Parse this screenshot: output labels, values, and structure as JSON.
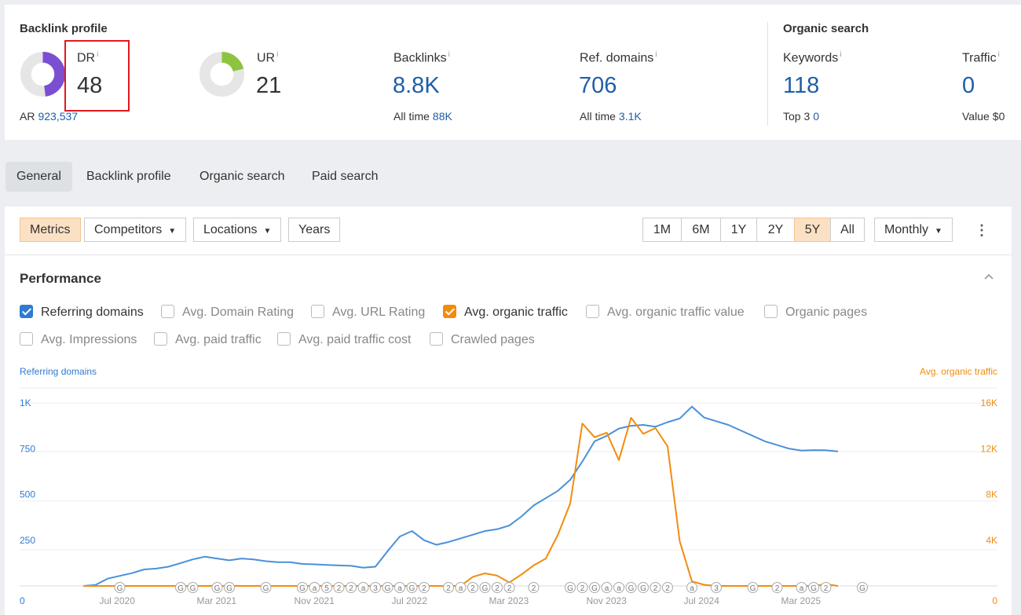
{
  "summary": {
    "backlink_title": "Backlink profile",
    "organic_title": "Organic search",
    "dr": {
      "label": "DR",
      "info": "i",
      "value": "48",
      "fraction": 0.48
    },
    "ar": {
      "label": "AR",
      "value": "923,537"
    },
    "ur": {
      "label": "UR",
      "info": "i",
      "value": "21",
      "fraction": 0.21
    },
    "backlinks": {
      "label": "Backlinks",
      "info": "i",
      "value": "8.8K",
      "sub_label": "All time",
      "sub_value": "88K"
    },
    "ref_domains": {
      "label": "Ref. domains",
      "info": "i",
      "value": "706",
      "sub_label": "All time",
      "sub_value": "3.1K"
    },
    "keywords": {
      "label": "Keywords",
      "info": "i",
      "value": "118",
      "sub_label": "Top 3",
      "sub_value": "0"
    },
    "traffic": {
      "label": "Traffic",
      "info": "i",
      "value": "0",
      "sub_label": "Value",
      "sub_value": "$0"
    }
  },
  "colors": {
    "dr_purple": "#7b4fd1",
    "ur_green": "#8cc43f",
    "blue": "#1f5ea8",
    "series_blue": "#4a90d9",
    "series_orange": "#f28c0e",
    "highlight_red": "#e0191f"
  },
  "tabs": [
    {
      "label": "General",
      "active": true
    },
    {
      "label": "Backlink profile"
    },
    {
      "label": "Organic search"
    },
    {
      "label": "Paid search"
    }
  ],
  "toolbar": {
    "metrics": "Metrics",
    "competitors": "Competitors",
    "locations": "Locations",
    "years": "Years",
    "ranges": [
      "1M",
      "6M",
      "1Y",
      "2Y",
      "5Y",
      "All"
    ],
    "active_range": "5Y",
    "interval": "Monthly"
  },
  "performance": {
    "title": "Performance",
    "checkboxes": [
      {
        "label": "Referring domains",
        "checked": true
      },
      {
        "label": "Avg. Domain Rating",
        "checked": false
      },
      {
        "label": "Avg. URL Rating",
        "checked": false
      },
      {
        "label": "Avg. organic traffic",
        "checked": true
      },
      {
        "label": "Avg. organic traffic value",
        "checked": false
      },
      {
        "label": "Organic pages",
        "checked": false
      },
      {
        "label": "Avg. Impressions",
        "checked": false
      },
      {
        "label": "Avg. paid traffic",
        "checked": false
      },
      {
        "label": "Avg. paid traffic cost",
        "checked": false
      },
      {
        "label": "Crawled pages",
        "checked": false
      }
    ]
  },
  "chart_data": {
    "type": "line",
    "left_axis_label": "Referring domains",
    "right_axis_label": "Avg. organic traffic",
    "left_ticks": [
      "0",
      "250",
      "500",
      "750",
      "1K"
    ],
    "right_ticks": [
      "0",
      "4K",
      "8K",
      "12K",
      "16K"
    ],
    "ylim_left": [
      0,
      1000
    ],
    "ylim_right": [
      0,
      16000
    ],
    "x_labels": [
      {
        "label": "Jul 2020",
        "month": 3
      },
      {
        "label": "Mar 2021",
        "month": 11
      },
      {
        "label": "Nov 2021",
        "month": 19
      },
      {
        "label": "Jul 2022",
        "month": 27
      },
      {
        "label": "Mar 2023",
        "month": 35
      },
      {
        "label": "Nov 2023",
        "month": 43
      },
      {
        "label": "Jul 2024",
        "month": 51
      },
      {
        "label": "Mar 2025",
        "month": 59
      }
    ],
    "series": [
      {
        "name": "Referring domains",
        "axis": "left",
        "points": [
          [
            0,
            0
          ],
          [
            1,
            5
          ],
          [
            2,
            40
          ],
          [
            3,
            55
          ],
          [
            4,
            70
          ],
          [
            5,
            90
          ],
          [
            6,
            95
          ],
          [
            7,
            105
          ],
          [
            8,
            125
          ],
          [
            9,
            145
          ],
          [
            10,
            160
          ],
          [
            11,
            150
          ],
          [
            12,
            140
          ],
          [
            13,
            150
          ],
          [
            14,
            145
          ],
          [
            15,
            135
          ],
          [
            16,
            130
          ],
          [
            17,
            130
          ],
          [
            18,
            120
          ],
          [
            19,
            118
          ],
          [
            20,
            115
          ],
          [
            21,
            112
          ],
          [
            22,
            110
          ],
          [
            23,
            100
          ],
          [
            24,
            105
          ],
          [
            25,
            190
          ],
          [
            26,
            270
          ],
          [
            27,
            300
          ],
          [
            28,
            250
          ],
          [
            29,
            225
          ],
          [
            30,
            240
          ],
          [
            31,
            260
          ],
          [
            32,
            280
          ],
          [
            33,
            300
          ],
          [
            34,
            310
          ],
          [
            35,
            330
          ],
          [
            36,
            380
          ],
          [
            37,
            440
          ],
          [
            38,
            480
          ],
          [
            39,
            520
          ],
          [
            40,
            580
          ],
          [
            41,
            680
          ],
          [
            42,
            790
          ],
          [
            43,
            820
          ],
          [
            44,
            860
          ],
          [
            45,
            875
          ],
          [
            46,
            880
          ],
          [
            47,
            870
          ],
          [
            48,
            895
          ],
          [
            49,
            915
          ],
          [
            50,
            980
          ],
          [
            51,
            920
          ],
          [
            52,
            900
          ],
          [
            53,
            880
          ],
          [
            54,
            850
          ],
          [
            55,
            820
          ],
          [
            56,
            790
          ],
          [
            57,
            770
          ],
          [
            58,
            750
          ],
          [
            59,
            740
          ],
          [
            60,
            742
          ],
          [
            61,
            741
          ],
          [
            62,
            735
          ]
        ]
      },
      {
        "name": "Avg. organic traffic",
        "axis": "right",
        "points": [
          [
            0,
            0
          ],
          [
            1,
            0
          ],
          [
            2,
            0
          ],
          [
            3,
            0
          ],
          [
            4,
            0
          ],
          [
            5,
            0
          ],
          [
            6,
            0
          ],
          [
            7,
            0
          ],
          [
            8,
            0
          ],
          [
            9,
            0
          ],
          [
            10,
            0
          ],
          [
            11,
            0
          ],
          [
            12,
            0
          ],
          [
            13,
            0
          ],
          [
            14,
            0
          ],
          [
            15,
            0
          ],
          [
            16,
            0
          ],
          [
            17,
            0
          ],
          [
            18,
            0
          ],
          [
            19,
            0
          ],
          [
            20,
            0
          ],
          [
            21,
            0
          ],
          [
            22,
            0
          ],
          [
            23,
            0
          ],
          [
            24,
            0
          ],
          [
            25,
            0
          ],
          [
            26,
            0
          ],
          [
            27,
            0
          ],
          [
            28,
            0
          ],
          [
            29,
            0
          ],
          [
            30,
            0
          ],
          [
            31,
            0
          ],
          [
            32,
            800
          ],
          [
            33,
            1100
          ],
          [
            34,
            900
          ],
          [
            35,
            300
          ],
          [
            36,
            1000
          ],
          [
            37,
            1800
          ],
          [
            38,
            2400
          ],
          [
            39,
            4500
          ],
          [
            40,
            7200
          ],
          [
            41,
            14200
          ],
          [
            42,
            13000
          ],
          [
            43,
            13400
          ],
          [
            44,
            11000
          ],
          [
            45,
            14700
          ],
          [
            46,
            13300
          ],
          [
            47,
            13800
          ],
          [
            48,
            12200
          ],
          [
            49,
            3900
          ],
          [
            50,
            400
          ],
          [
            51,
            100
          ],
          [
            52,
            0
          ],
          [
            53,
            0
          ],
          [
            54,
            0
          ],
          [
            55,
            0
          ],
          [
            56,
            0
          ],
          [
            57,
            0
          ],
          [
            58,
            0
          ],
          [
            59,
            0
          ],
          [
            60,
            0
          ],
          [
            61,
            150
          ],
          [
            62,
            0
          ]
        ]
      }
    ],
    "annotations": [
      {
        "month": 3,
        "mark": "G"
      },
      {
        "month": 8,
        "mark": "G"
      },
      {
        "month": 9,
        "mark": "G"
      },
      {
        "month": 11,
        "mark": "G"
      },
      {
        "month": 12,
        "mark": "G"
      },
      {
        "month": 15,
        "mark": "G"
      },
      {
        "month": 18,
        "mark": "G"
      },
      {
        "month": 19,
        "mark": "a"
      },
      {
        "month": 20,
        "mark": "5"
      },
      {
        "month": 21,
        "mark": "2"
      },
      {
        "month": 22,
        "mark": "2"
      },
      {
        "month": 23,
        "mark": "a"
      },
      {
        "month": 24,
        "mark": "3"
      },
      {
        "month": 25,
        "mark": "G"
      },
      {
        "month": 26,
        "mark": "a"
      },
      {
        "month": 27,
        "mark": "G"
      },
      {
        "month": 28,
        "mark": "2"
      },
      {
        "month": 30,
        "mark": "2"
      },
      {
        "month": 31,
        "mark": "a"
      },
      {
        "month": 32,
        "mark": "2"
      },
      {
        "month": 33,
        "mark": "G"
      },
      {
        "month": 34,
        "mark": "2"
      },
      {
        "month": 35,
        "mark": "2"
      },
      {
        "month": 37,
        "mark": "2"
      },
      {
        "month": 40,
        "mark": "G"
      },
      {
        "month": 41,
        "mark": "2"
      },
      {
        "month": 42,
        "mark": "G"
      },
      {
        "month": 43,
        "mark": "a"
      },
      {
        "month": 44,
        "mark": "a"
      },
      {
        "month": 45,
        "mark": "G"
      },
      {
        "month": 46,
        "mark": "G"
      },
      {
        "month": 47,
        "mark": "2"
      },
      {
        "month": 48,
        "mark": "2"
      },
      {
        "month": 50,
        "mark": "a"
      },
      {
        "month": 52,
        "mark": "3"
      },
      {
        "month": 55,
        "mark": "G"
      },
      {
        "month": 57,
        "mark": "2"
      },
      {
        "month": 59,
        "mark": "a"
      },
      {
        "month": 60,
        "mark": "G"
      },
      {
        "month": 61,
        "mark": "2"
      },
      {
        "month": 64,
        "mark": "G"
      }
    ]
  }
}
